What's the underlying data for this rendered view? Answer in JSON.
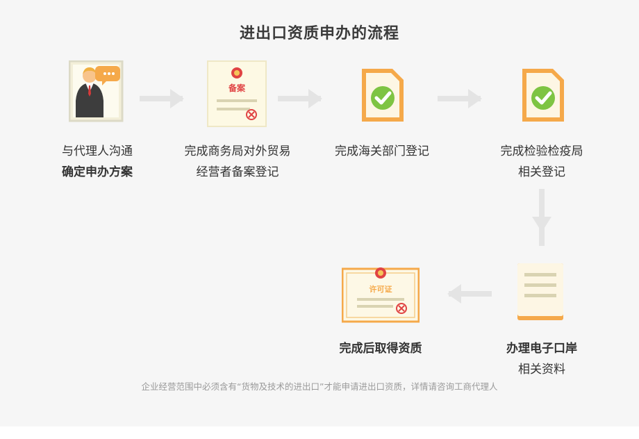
{
  "title": "进出口资质申办的流程",
  "steps": [
    {
      "line1": "与代理人沟通",
      "line2": "确定申办方案"
    },
    {
      "line1": "完成商务局对外贸易",
      "line2": "经营者备案登记",
      "badge": "备案"
    },
    {
      "line1": "完成海关部门登记",
      "line2": ""
    },
    {
      "line1": "完成检验检疫局",
      "line2": "相关登记"
    },
    {
      "line1": "办理电子口岸",
      "line2": "相关资料"
    },
    {
      "line1": "完成后取得资质",
      "line2": "",
      "badge": "许可证"
    }
  ],
  "note": "企业经营范围中必须含有“货物及技术的进出口”才能申请进出口资质，详情请咨询工商代理人",
  "colors": {
    "orange": "#f5a94a",
    "green": "#7ec443",
    "arrow": "#e4e4e4",
    "seal_red": "#e04343"
  }
}
